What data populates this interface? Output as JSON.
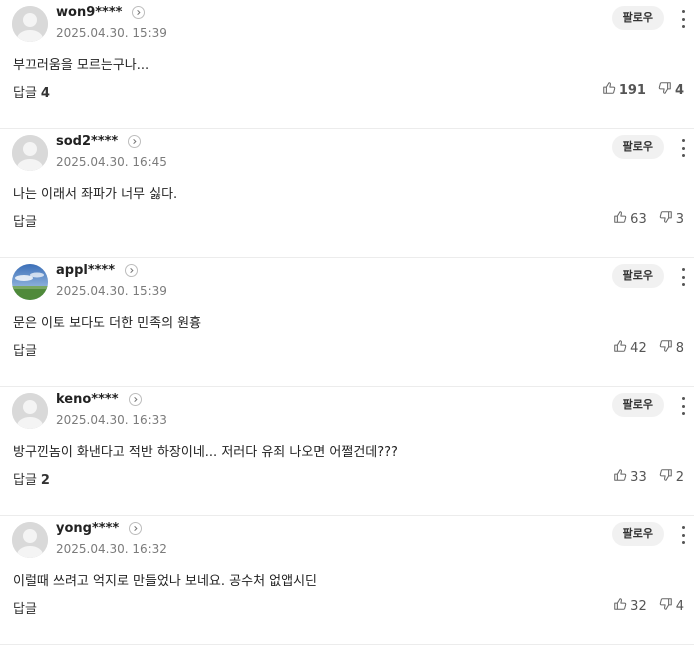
{
  "follow_label": "팔로우",
  "reply_label": "답글",
  "comments": [
    {
      "user": "won9****",
      "time": "2025.04.30. 15:39",
      "text": "부끄러움을 모르는구나...",
      "reply_count": "4",
      "likes": "191",
      "dislikes": "4",
      "avatar": "default"
    },
    {
      "user": "sod2****",
      "time": "2025.04.30. 16:45",
      "text": "나는 이래서 좌파가 너무 싫다.",
      "reply_count": "",
      "likes": "63",
      "dislikes": "3",
      "avatar": "default"
    },
    {
      "user": "appl****",
      "time": "2025.04.30. 15:39",
      "text": "문은 이토 보다도 더한 민족의 원흉",
      "reply_count": "",
      "likes": "42",
      "dislikes": "8",
      "avatar": "landscape"
    },
    {
      "user": "keno****",
      "time": "2025.04.30. 16:33",
      "text": "방구낀놈이 화낸다고 적반 하장이네... 저러다 유죄 나오면 어쩔건데???",
      "reply_count": "2",
      "likes": "33",
      "dislikes": "2",
      "avatar": "default"
    },
    {
      "user": "yong****",
      "time": "2025.04.30. 16:32",
      "text": "이럴때 쓰려고 억지로 만들었나 보네요. 공수처 없앱시딘",
      "reply_count": "",
      "likes": "32",
      "dislikes": "4",
      "avatar": "default"
    }
  ]
}
